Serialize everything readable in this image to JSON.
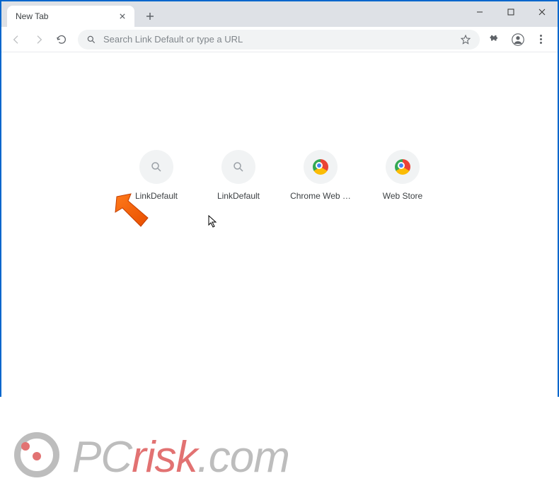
{
  "tab": {
    "title": "New Tab"
  },
  "omnibox": {
    "placeholder": "Search Link Default or type a URL"
  },
  "shortcuts": [
    {
      "label": "LinkDefault",
      "icon": "search"
    },
    {
      "label": "LinkDefault",
      "icon": "search"
    },
    {
      "label": "Chrome Web …",
      "icon": "chrome"
    },
    {
      "label": "Web Store",
      "icon": "chrome"
    }
  ],
  "watermark": {
    "text_pre": "PC",
    "text_red": "risk",
    "text_post": ".com"
  }
}
